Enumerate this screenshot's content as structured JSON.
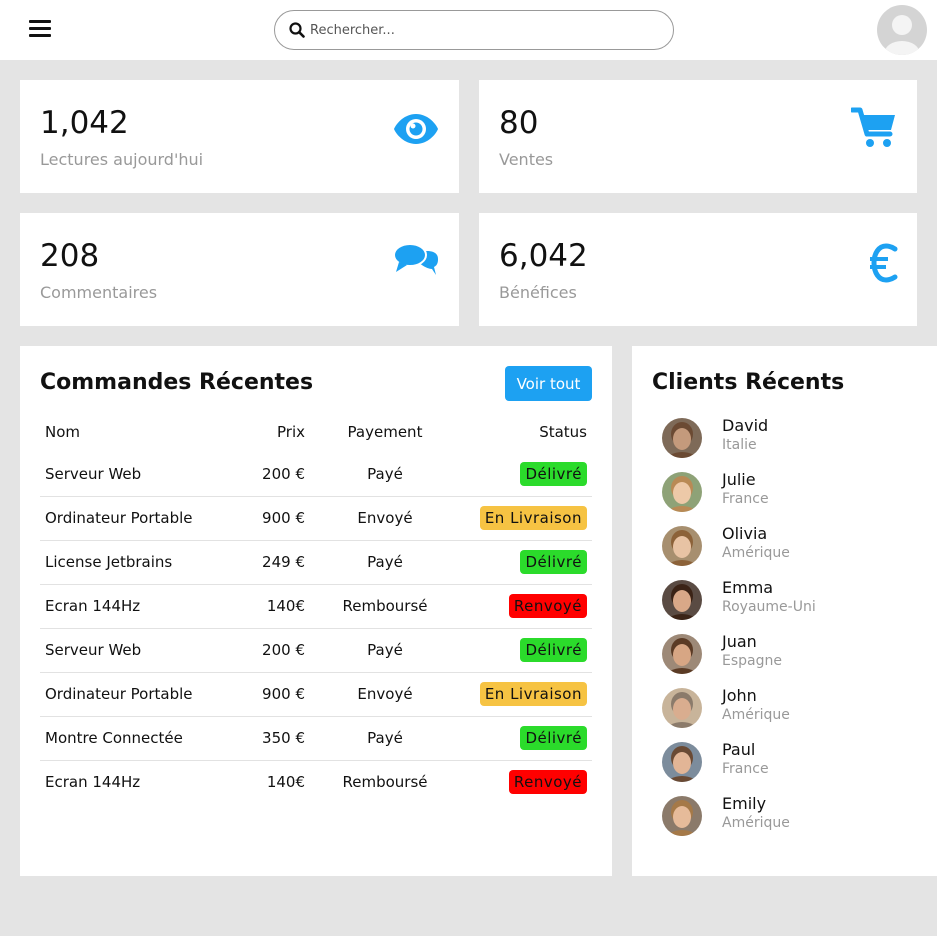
{
  "header": {
    "search_placeholder": "Rechercher..."
  },
  "stats": [
    {
      "value": "1,042",
      "label": "Lectures aujourd'hui",
      "icon": "eye-icon"
    },
    {
      "value": "80",
      "label": "Ventes",
      "icon": "cart-icon"
    },
    {
      "value": "208",
      "label": "Commentaires",
      "icon": "comments-icon"
    },
    {
      "value": "6,042",
      "label": "Bénéfices",
      "icon": "euro-icon"
    }
  ],
  "colors": {
    "accent": "#1da1f2",
    "delivered": "#2bdb2b",
    "in_transit": "#f6c343",
    "returned": "#ff0000"
  },
  "orders": {
    "title": "Commandes Récentes",
    "view_all_label": "Voir tout",
    "columns": [
      "Nom",
      "Prix",
      "Payement",
      "Status"
    ],
    "rows": [
      {
        "name": "Serveur Web",
        "price": "200 €",
        "payment": "Payé",
        "status": "Délivré",
        "status_type": "delivered"
      },
      {
        "name": "Ordinateur Portable",
        "price": "900 €",
        "payment": "Envoyé",
        "status": "En Livraison",
        "status_type": "in_transit"
      },
      {
        "name": "License Jetbrains",
        "price": "249 €",
        "payment": "Payé",
        "status": "Délivré",
        "status_type": "delivered"
      },
      {
        "name": "Ecran 144Hz",
        "price": "140€",
        "payment": "Remboursé",
        "status": "Renvoyé",
        "status_type": "returned"
      },
      {
        "name": "Serveur Web",
        "price": "200 €",
        "payment": "Payé",
        "status": "Délivré",
        "status_type": "delivered"
      },
      {
        "name": "Ordinateur Portable",
        "price": "900 €",
        "payment": "Envoyé",
        "status": "En Livraison",
        "status_type": "in_transit"
      },
      {
        "name": "Montre Connectée",
        "price": "350 €",
        "payment": "Payé",
        "status": "Délivré",
        "status_type": "delivered"
      },
      {
        "name": "Ecran 144Hz",
        "price": "140€",
        "payment": "Remboursé",
        "status": "Renvoyé",
        "status_type": "returned"
      }
    ]
  },
  "clients": {
    "title": "Clients Récents",
    "items": [
      {
        "name": "David",
        "country": "Italie",
        "skin": "#c49a7c",
        "hair": "#6b4a33",
        "bg": "#7e6a58"
      },
      {
        "name": "Julie",
        "country": "France",
        "skin": "#edc9a8",
        "hair": "#b98a55",
        "bg": "#8ea277"
      },
      {
        "name": "Olivia",
        "country": "Amérique",
        "skin": "#e8c3a4",
        "hair": "#8c6239",
        "bg": "#a78f6f"
      },
      {
        "name": "Emma",
        "country": "Royaume-Uni",
        "skin": "#d9a888",
        "hair": "#3b2316",
        "bg": "#5a4b43"
      },
      {
        "name": "Juan",
        "country": "Espagne",
        "skin": "#d7a684",
        "hair": "#5b3b25",
        "bg": "#9d8977"
      },
      {
        "name": "John",
        "country": "Amérique",
        "skin": "#d9ad8f",
        "hair": "#8b7b6b",
        "bg": "#c8b49a"
      },
      {
        "name": "Paul",
        "country": "France",
        "skin": "#e2b596",
        "hair": "#6a4a34",
        "bg": "#7c8c9c"
      },
      {
        "name": "Emily",
        "country": "Amérique",
        "skin": "#e6bb9a",
        "hair": "#a57948",
        "bg": "#8b7a6a"
      }
    ]
  }
}
